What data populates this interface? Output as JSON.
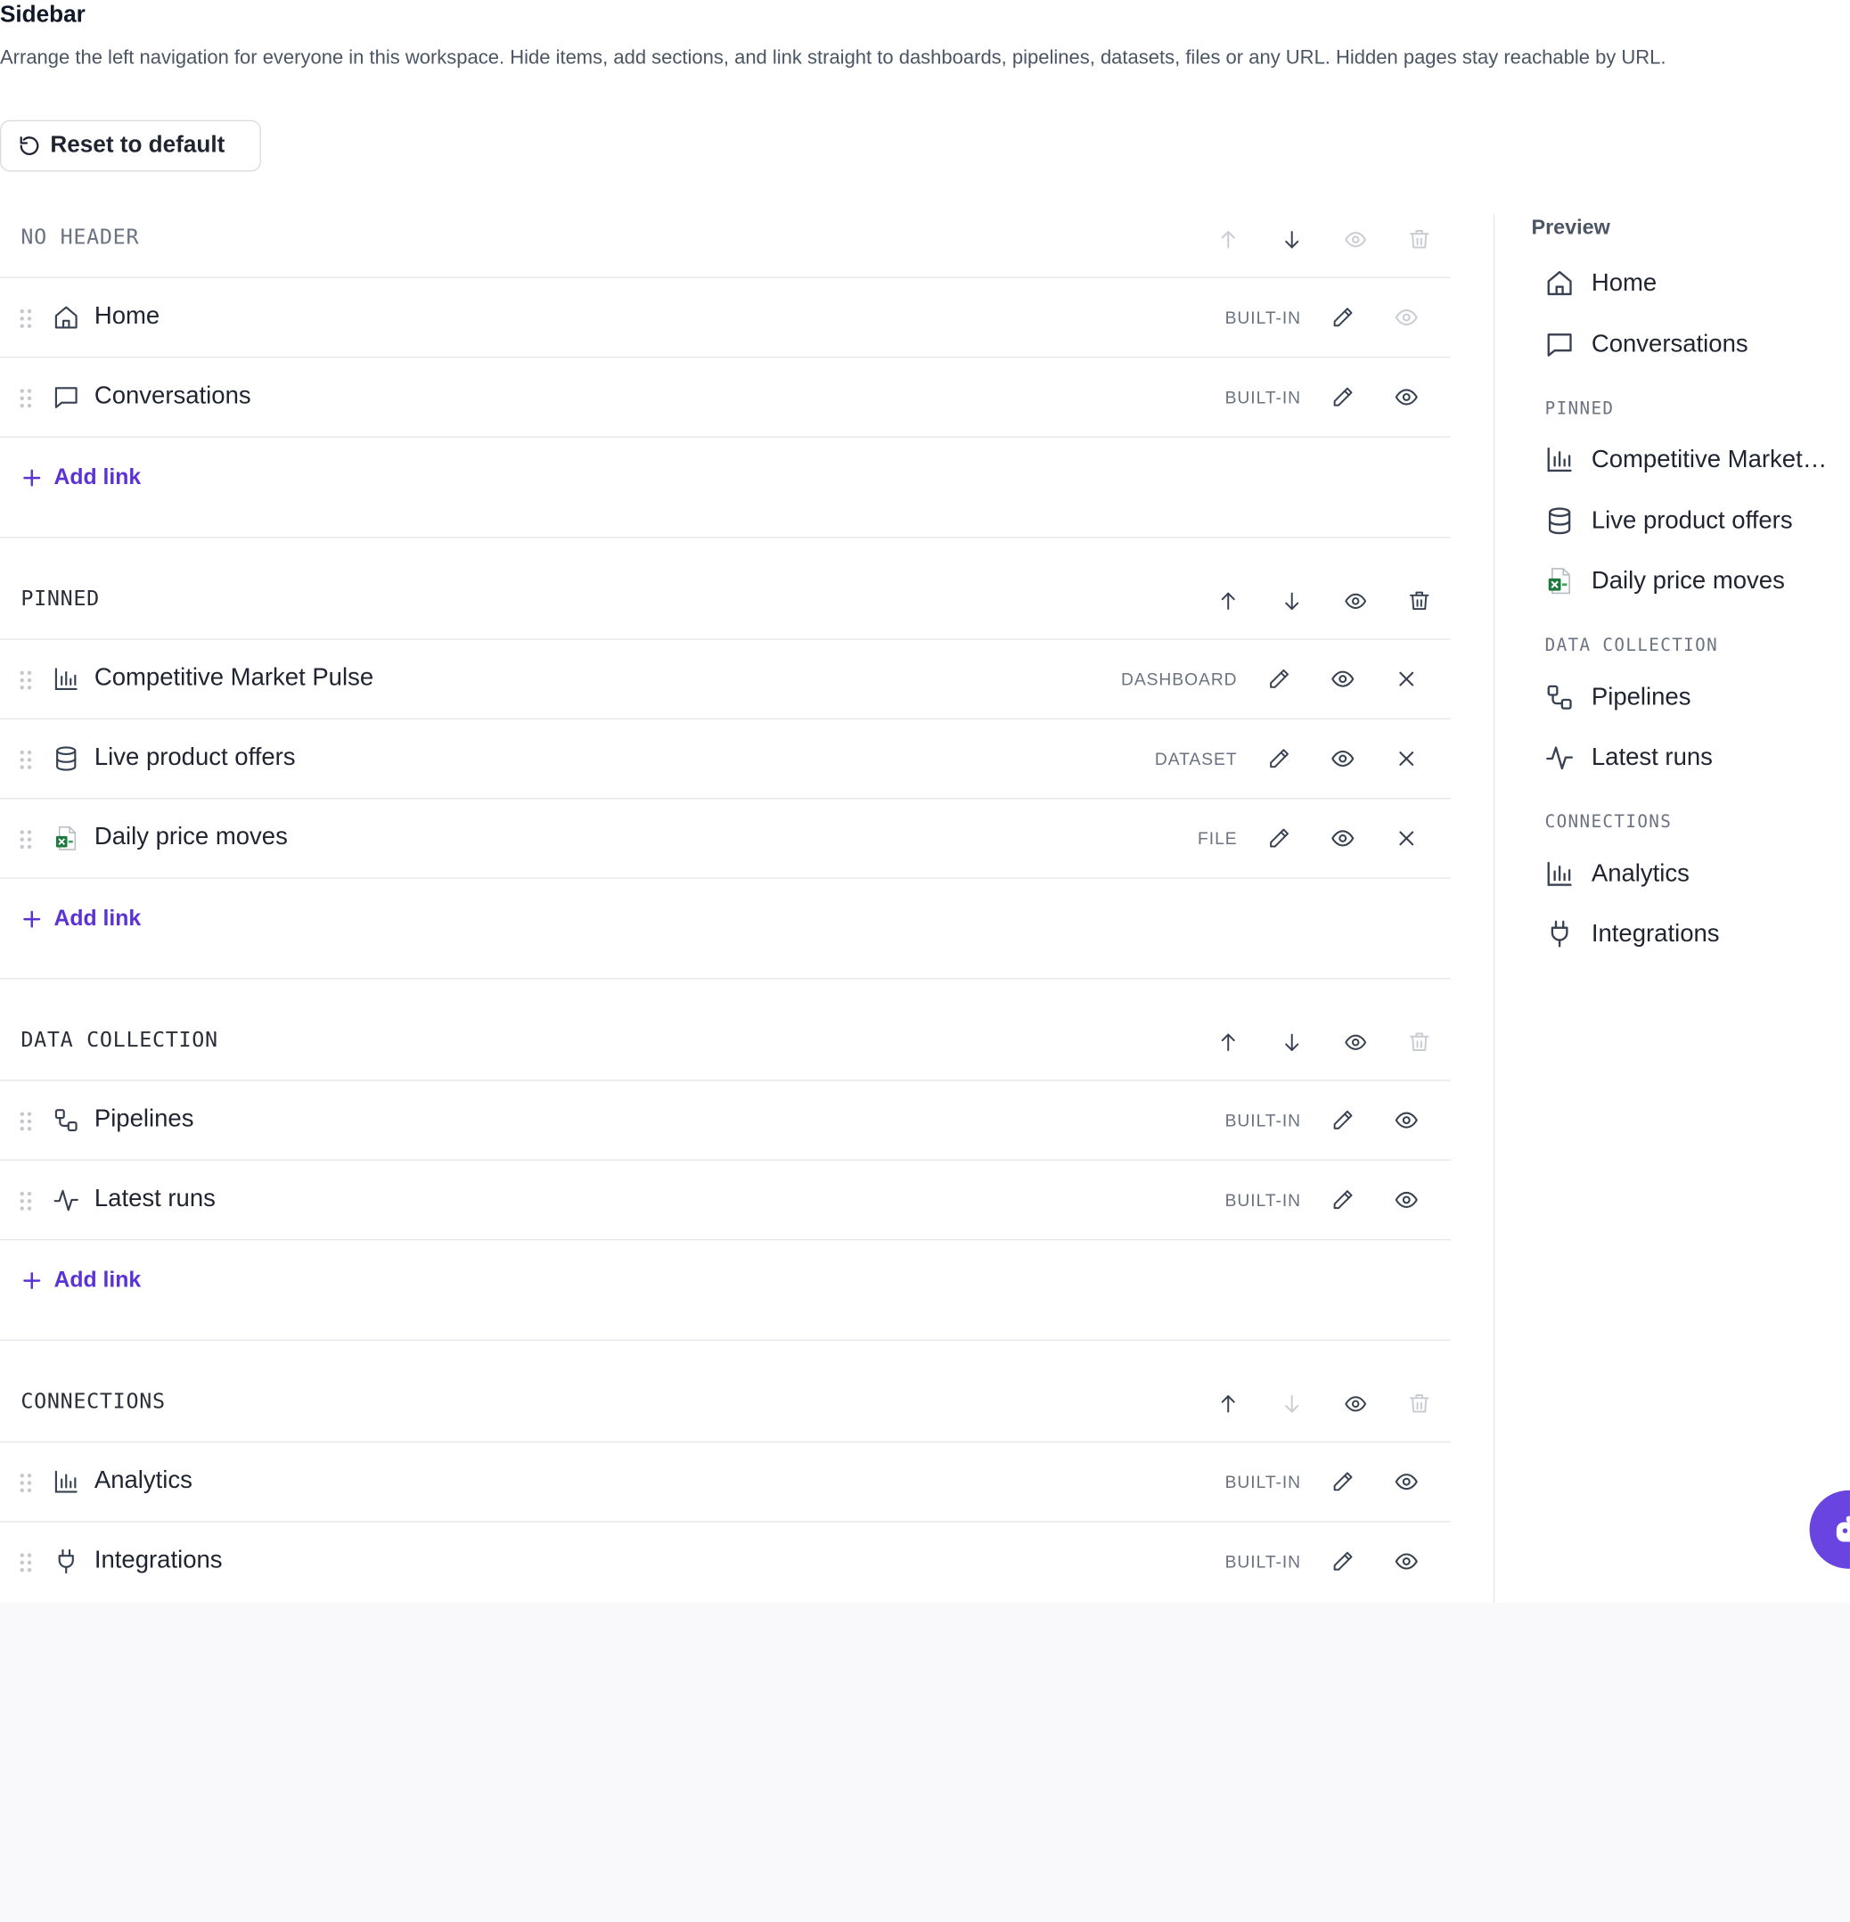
{
  "page": {
    "title": "Sidebar",
    "description": "Arrange the left navigation for everyone in this workspace. Hide items, add sections, and link straight to dashboards, pipelines, datasets, files or any URL. Hidden pages stay reachable by URL.",
    "reset_label": "Reset to default",
    "add_link_label": "Add link"
  },
  "sections": [
    {
      "title": "NO HEADER",
      "items": [
        {
          "label": "Home",
          "tag": "BUILT-IN",
          "icon": "home-icon"
        },
        {
          "label": "Conversations",
          "tag": "BUILT-IN",
          "icon": "chat-icon"
        }
      ]
    },
    {
      "title": "PINNED",
      "items": [
        {
          "label": "Competitive Market Pulse",
          "tag": "DASHBOARD",
          "icon": "bar-chart-icon"
        },
        {
          "label": "Live product offers",
          "tag": "DATASET",
          "icon": "database-icon"
        },
        {
          "label": "Daily price moves",
          "tag": "FILE",
          "icon": "excel-file-icon"
        }
      ]
    },
    {
      "title": "DATA COLLECTION",
      "items": [
        {
          "label": "Pipelines",
          "tag": "BUILT-IN",
          "icon": "pipeline-icon"
        },
        {
          "label": "Latest runs",
          "tag": "BUILT-IN",
          "icon": "activity-icon"
        }
      ]
    },
    {
      "title": "CONNECTIONS",
      "items": [
        {
          "label": "Analytics",
          "tag": "BUILT-IN",
          "icon": "bar-chart-icon"
        },
        {
          "label": "Integrations",
          "tag": "BUILT-IN",
          "icon": "plug-icon"
        }
      ]
    }
  ],
  "preview": {
    "title": "Preview",
    "items": [
      {
        "label": "Home",
        "icon": "home-icon"
      },
      {
        "label": "Conversations",
        "icon": "chat-icon"
      },
      {
        "label": "Competitive Market…",
        "icon": "bar-chart-icon"
      },
      {
        "label": "Live product offers",
        "icon": "database-icon"
      },
      {
        "label": "Daily price moves",
        "icon": "excel-file-icon"
      },
      {
        "label": "Pipelines",
        "icon": "pipeline-icon"
      },
      {
        "label": "Latest runs",
        "icon": "activity-icon"
      },
      {
        "label": "Analytics",
        "icon": "bar-chart-icon"
      },
      {
        "label": "Integrations",
        "icon": "plug-icon"
      }
    ],
    "sections": [
      "PINNED",
      "DATA COLLECTION",
      "CONNECTIONS"
    ]
  },
  "colors": {
    "accent": "#5b32d6",
    "fab": "#6a44e0",
    "border": "#e5e7eb",
    "muted_text": "#6b7280",
    "excel_green": "#1d7a3e"
  }
}
